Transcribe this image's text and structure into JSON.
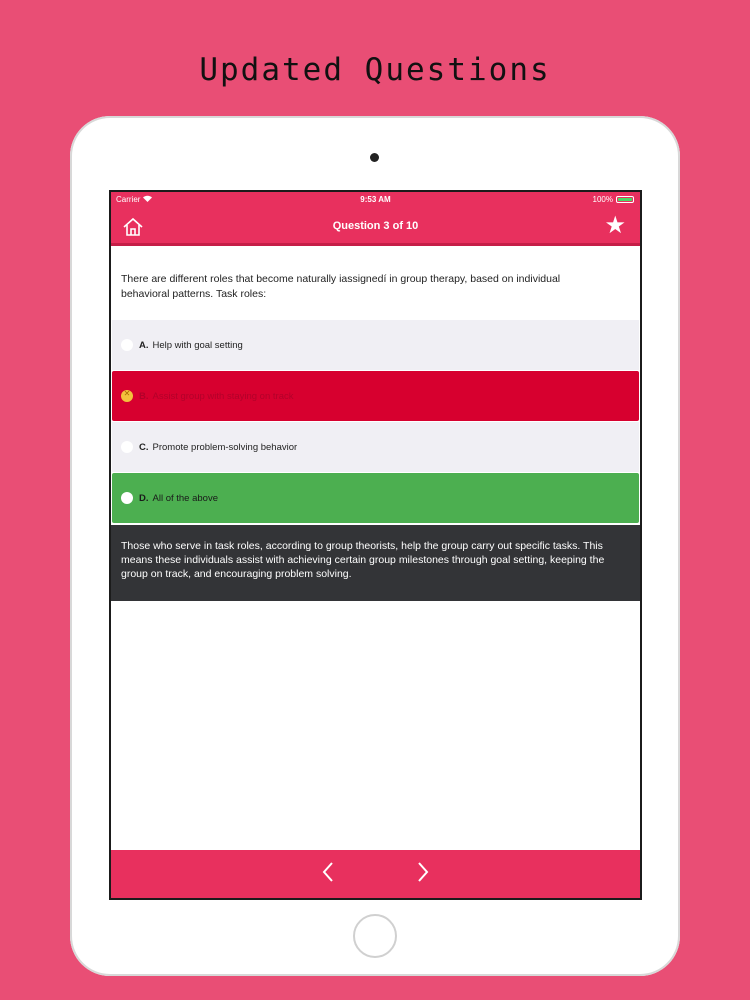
{
  "headline": "Updated Questions",
  "status_bar": {
    "carrier": "Carrier",
    "time": "9:53 AM",
    "battery": "100%"
  },
  "nav": {
    "title": "Question 3 of 10",
    "home_icon": "home-icon",
    "star_icon": "star-icon"
  },
  "question": {
    "text": "There are different roles that become naturally iassignedí in group therapy, based on individual behavioral patterns. Task roles:"
  },
  "options": [
    {
      "letter": "A.",
      "text": "Help with goal setting",
      "state": "neutral"
    },
    {
      "letter": "B.",
      "text": "Assist group with staying on track",
      "state": "wrong"
    },
    {
      "letter": "C.",
      "text": "Promote problem-solving behavior",
      "state": "neutral"
    },
    {
      "letter": "D.",
      "text": "All of the above",
      "state": "correct"
    }
  ],
  "explanation": "Those who serve in task roles, according to group theorists, help the group carry out specific tasks. This means these individuals assist with achieving certain group milestones through goal setting, keeping the group on track, and encouraging problem solving.",
  "footer": {
    "prev_icon": "chevron-left-icon",
    "next_icon": "chevron-right-icon"
  },
  "colors": {
    "background": "#e94e75",
    "bar": "#e8305e",
    "wrong": "#d7002f",
    "correct": "#4caf50",
    "explanation_bg": "#333437"
  }
}
